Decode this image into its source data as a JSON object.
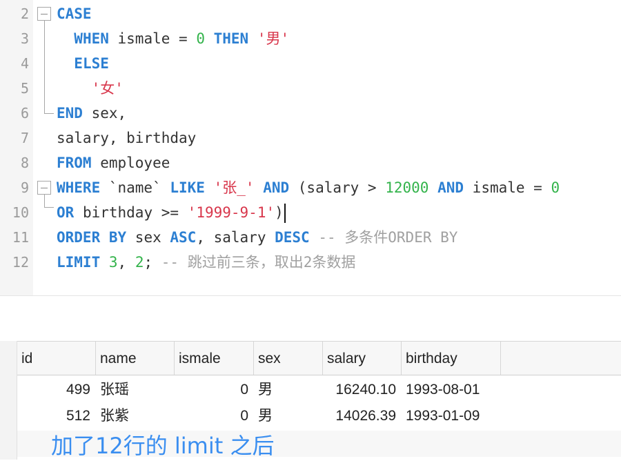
{
  "editor": {
    "lines": [
      {
        "num": "2",
        "tokens": [
          {
            "t": "CASE",
            "c": "kw"
          }
        ]
      },
      {
        "num": "3",
        "tokens": [
          {
            "t": "  "
          },
          {
            "t": "WHEN",
            "c": "kw"
          },
          {
            "t": " ismale = "
          },
          {
            "t": "0",
            "c": "num"
          },
          {
            "t": " "
          },
          {
            "t": "THEN",
            "c": "kw"
          },
          {
            "t": " "
          },
          {
            "t": "'男'",
            "c": "str"
          }
        ]
      },
      {
        "num": "4",
        "tokens": [
          {
            "t": "  "
          },
          {
            "t": "ELSE",
            "c": "kw"
          }
        ]
      },
      {
        "num": "5",
        "tokens": [
          {
            "t": "    "
          },
          {
            "t": "'女'",
            "c": "str"
          }
        ]
      },
      {
        "num": "6",
        "tokens": [
          {
            "t": "END",
            "c": "kw"
          },
          {
            "t": " sex,"
          }
        ]
      },
      {
        "num": "7",
        "tokens": [
          {
            "t": "salary, birthday"
          }
        ]
      },
      {
        "num": "8",
        "tokens": [
          {
            "t": "FROM",
            "c": "kw"
          },
          {
            "t": " employee"
          }
        ]
      },
      {
        "num": "9",
        "tokens": [
          {
            "t": "WHERE",
            "c": "kw"
          },
          {
            "t": " `name` "
          },
          {
            "t": "LIKE",
            "c": "kw"
          },
          {
            "t": " "
          },
          {
            "t": "'张_'",
            "c": "str"
          },
          {
            "t": " "
          },
          {
            "t": "AND",
            "c": "kw"
          },
          {
            "t": " (salary > "
          },
          {
            "t": "12000",
            "c": "num"
          },
          {
            "t": " "
          },
          {
            "t": "AND",
            "c": "kw"
          },
          {
            "t": " ismale = "
          },
          {
            "t": "0",
            "c": "num"
          }
        ]
      },
      {
        "num": "10",
        "tokens": [
          {
            "t": "OR",
            "c": "kw"
          },
          {
            "t": " birthday >= "
          },
          {
            "t": "'1999-9-1'",
            "c": "str"
          },
          {
            "t": ")"
          }
        ],
        "cursor": true
      },
      {
        "num": "11",
        "tokens": [
          {
            "t": "ORDER BY",
            "c": "kw"
          },
          {
            "t": " sex "
          },
          {
            "t": "ASC",
            "c": "kw"
          },
          {
            "t": ", salary "
          },
          {
            "t": "DESC",
            "c": "kw"
          },
          {
            "t": " -- 多条件ORDER BY",
            "c": "cm"
          }
        ]
      },
      {
        "num": "12",
        "tokens": [
          {
            "t": "LIMIT",
            "c": "kw"
          },
          {
            "t": " "
          },
          {
            "t": "3",
            "c": "num"
          },
          {
            "t": ", "
          },
          {
            "t": "2",
            "c": "num"
          },
          {
            "t": "; "
          },
          {
            "t": "-- 跳过前三条，取出2条数据",
            "c": "cm"
          }
        ]
      }
    ]
  },
  "results": {
    "columns": [
      "id",
      "name",
      "ismale",
      "sex",
      "salary",
      "birthday"
    ],
    "rows": [
      [
        "499",
        "张瑶",
        "0",
        "男",
        "16240.10",
        "1993-08-01"
      ],
      [
        "512",
        "张紫",
        "0",
        "男",
        "14026.39",
        "1993-01-09"
      ]
    ]
  },
  "annotation": "加了12行的 limit 之后",
  "colors": {
    "keyword": "#2c7fd2",
    "string": "#d8364b",
    "number": "#33b34b",
    "comment": "#a0a0a0",
    "annotation": "#3a8ef0"
  }
}
